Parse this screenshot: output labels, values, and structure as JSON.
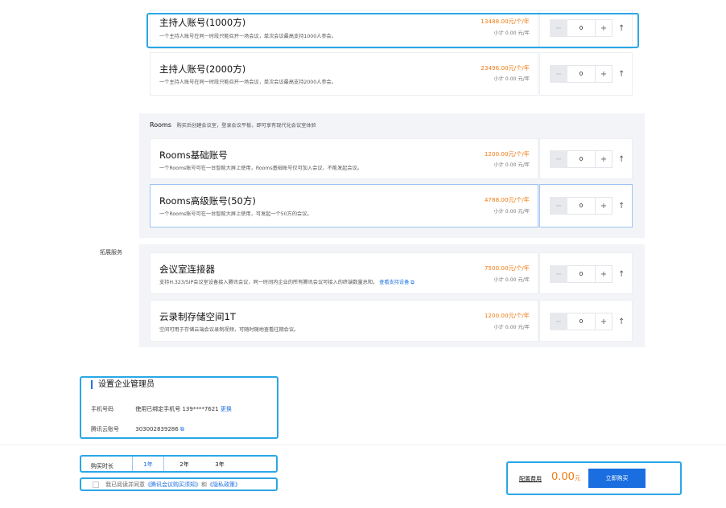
{
  "products_top": [
    {
      "name": "主持人账号(1000方)",
      "desc": "一个主持人账号在同一时段只能召开一场会议，单次会议最高支持1000人参会。",
      "price": "13488.00元/个/年",
      "subtotal": "小计 0.00 元/年",
      "qty": "0"
    },
    {
      "name": "主持人账号(2000方)",
      "desc": "一个主持人账号在同一时段只能召开一场会议，单次会议最高支持2000人参会。",
      "price": "23496.00元/个/年",
      "subtotal": "小计 0.00 元/年",
      "qty": "0"
    }
  ],
  "rooms": {
    "title": "Rooms",
    "subtitle": "购买后创建会议室，登录会议平板，即可享有现代化会议室体验",
    "items": [
      {
        "name": "Rooms基础账号",
        "desc": "一个Rooms账号可在一台智能大屏上使用，Rooms基础账号仅可加入会议，不能发起会议。",
        "price": "1200.00元/个/年",
        "subtotal": "小计 0.00 元/年",
        "qty": "0"
      },
      {
        "name": "Rooms高级账号(50方)",
        "desc": "一个Rooms账号可在一台智能大屏上使用，可发起一个50方的会议。",
        "price": "4788.00元/个/年",
        "subtotal": "小计 0.00 元/年",
        "qty": "0"
      }
    ]
  },
  "extension": {
    "label": "拓展服务",
    "items": [
      {
        "name": "会议室连接器",
        "desc": "支持H.323/SIP会议室设备接入腾讯会议，同一时间内企业的所有腾讯会议可接入的终端数量总和，",
        "link": "查看支持设备",
        "price": "7500.00元/个/年",
        "subtotal": "小计 0.00 元/年",
        "qty": "0"
      },
      {
        "name": "云录制存储空间1T",
        "desc": "空间可用于存储云端会议录制视频，可随时随地查看往期会议。",
        "price": "1200.00元/个/年",
        "subtotal": "小计 0.00 元/年",
        "qty": "0"
      }
    ]
  },
  "admin": {
    "title": "设置企业管理员",
    "phone_label": "手机号码",
    "phone_value": "使用已绑定手机号 139****7621",
    "phone_change": "更换",
    "cloud_label": "腾讯云账号",
    "cloud_value": "303002839286"
  },
  "footer": {
    "duration_label": "购买时长",
    "durations": [
      "1年",
      "2年",
      "3年"
    ],
    "agree_prefix": "我已阅读并同意",
    "agree_link1": "《腾讯会议购买须知》",
    "agree_and": "和",
    "agree_link2": "《隐私政策》",
    "cost_label": "配置费用",
    "cost_value": "0.00",
    "cost_unit": "元",
    "buy_label": "立即购买"
  },
  "icons": {
    "minus": "−",
    "plus": "+",
    "up": "↑",
    "external": "⧉"
  },
  "colors": {
    "accent": "#1a6ee0",
    "price": "#f07a12",
    "highlight": "#2aa7e6"
  }
}
